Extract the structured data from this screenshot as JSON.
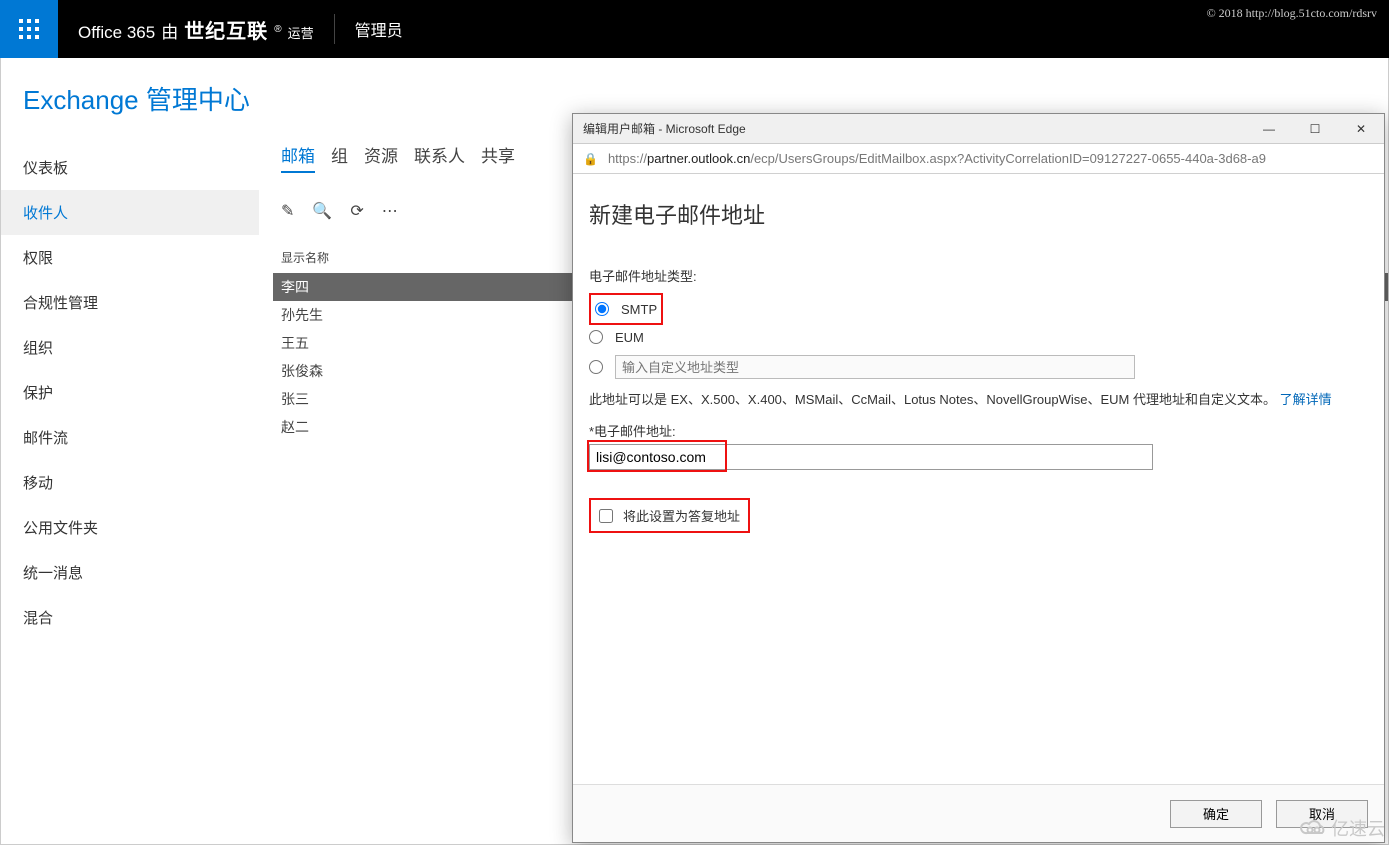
{
  "topbar": {
    "brand_left": "Office 365",
    "brand_by": "由",
    "brand_cn": "世纪互联",
    "brand_op": "运营",
    "admin": "管理员",
    "copyright": "© 2018 http://blog.51cto.com/rdsrv"
  },
  "page": {
    "title": "Exchange 管理中心"
  },
  "sidebar": {
    "items": [
      "仪表板",
      "收件人",
      "权限",
      "合规性管理",
      "组织",
      "保护",
      "邮件流",
      "移动",
      "公用文件夹",
      "统一消息",
      "混合"
    ],
    "active_index": 1
  },
  "tabs": {
    "items": [
      "邮箱",
      "组",
      "资源",
      "联系人",
      "共享"
    ],
    "active_index": 0
  },
  "list": {
    "column": "显示名称",
    "rows": [
      "李四",
      "孙先生",
      "王五",
      "张俊森",
      "张三",
      "赵二"
    ],
    "selected_index": 0
  },
  "popup": {
    "window_title": "编辑用户邮箱 - Microsoft Edge",
    "url_prefix": "https://",
    "url_host": "partner.outlook.cn",
    "url_path": "/ecp/UsersGroups/EditMailbox.aspx?ActivityCorrelationID=09127227-0655-440a-3d68-a9",
    "heading": "新建电子邮件地址",
    "type_label": "电子邮件地址类型:",
    "radio_smtp": "SMTP",
    "radio_eum": "EUM",
    "custom_placeholder": "输入自定义地址类型",
    "help_text": "此地址可以是 EX、X.500、X.400、MSMail、CcMail、Lotus Notes、NovellGroupWise、EUM 代理地址和自定义文本。",
    "help_link": "了解详情",
    "email_label": "*电子邮件地址:",
    "email_value": "lisi@contoso.com",
    "reply_checkbox": "将此设置为答复地址",
    "ok": "确定",
    "cancel": "取消"
  },
  "watermark": "亿速云"
}
